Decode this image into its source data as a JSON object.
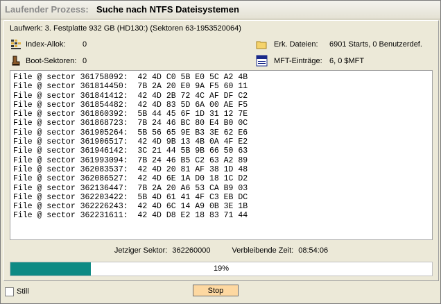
{
  "title": {
    "prefix": "Laufender Prozess:",
    "main": "Suche nach NTFS Dateisystemen"
  },
  "drive": "Laufwerk: 3. Festplatte 932 GB (HD130:) (Sektoren 63-1953520064)",
  "info": {
    "index_alloc_label": "Index-Allok:",
    "index_alloc_value": "0",
    "boot_sectors_label": "Boot-Sektoren:",
    "boot_sectors_value": "0",
    "found_files_label": "Erk. Dateien:",
    "found_files_value": "6901 Starts, 0 Benutzerdef.",
    "mft_label": "MFT-Einträge:",
    "mft_value": "6, 0 $MFT"
  },
  "hex_lines": [
    "File @ sector 361758092:  42 4D C0 5B E0 5C A2 4B",
    "File @ sector 361814450:  7B 2A 20 E0 9A F5 60 11",
    "File @ sector 361841412:  42 4D 2B 72 4C AF DF C2",
    "File @ sector 361854482:  42 4D 83 5D 6A 00 AE F5",
    "File @ sector 361860392:  5B 44 45 6F 1D 31 12 7E",
    "File @ sector 361868723:  7B 24 46 BC 80 E4 B0 0C",
    "File @ sector 361905264:  5B 56 65 9E B3 3E 62 E6",
    "File @ sector 361906517:  42 4D 9B 13 4B 0A 4F E2",
    "File @ sector 361946142:  3C 21 44 5B 9B 66 50 63",
    "File @ sector 361993094:  7B 24 46 B5 C2 63 A2 89",
    "File @ sector 362083537:  42 4D 20 81 AF 38 1D 48",
    "File @ sector 362086527:  42 4D 6E 1A D0 18 1C D2",
    "File @ sector 362136447:  7B 2A 20 A6 53 CA B9 03",
    "File @ sector 362203422:  5B 4D 61 41 4F C3 EB DC",
    "File @ sector 362226243:  42 4D 6C 14 A9 0B 3E 1B",
    "File @ sector 362231611:  42 4D D8 E2 18 83 71 44"
  ],
  "status": {
    "sector_label": "Jetziger Sektor:",
    "sector_value": "362260000",
    "remaining_label": "Verbleibende Zeit:",
    "remaining_value": "08:54:06"
  },
  "progress": {
    "percent_text": "19%",
    "fraction": 0.19,
    "fill_color": "#0d8a84"
  },
  "bottom": {
    "still_label": "Still",
    "still_checked": false,
    "stop_label": "Stop"
  },
  "icons": {
    "index_alloc": "index-grid-icon",
    "boot_sectors": "boot-icon",
    "found_files": "folder-icon",
    "mft": "file-icon"
  }
}
